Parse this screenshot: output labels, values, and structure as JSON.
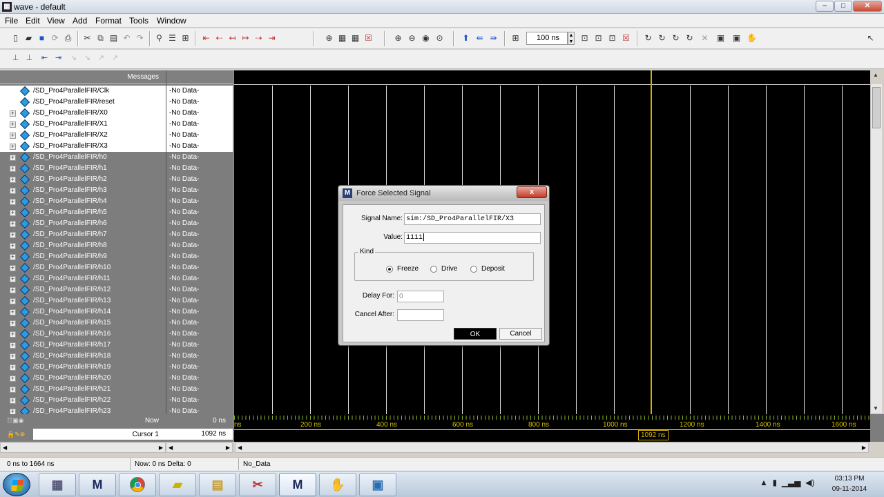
{
  "window": {
    "title": "wave - default",
    "controls": [
      "–",
      "□",
      "✕"
    ]
  },
  "menu": [
    "File",
    "Edit",
    "View",
    "Add",
    "Format",
    "Tools",
    "Window"
  ],
  "toolbar": {
    "time_value": "100 ns"
  },
  "messages_header": "Messages",
  "signals": [
    {
      "name": "/SD_Pro4ParallelFIR/Clk",
      "value": "-No Data-",
      "expandable": false,
      "selected": true
    },
    {
      "name": "/SD_Pro4ParallelFIR/reset",
      "value": "-No Data-",
      "expandable": false,
      "selected": true
    },
    {
      "name": "/SD_Pro4ParallelFIR/X0",
      "value": "-No Data-",
      "expandable": true,
      "selected": true
    },
    {
      "name": "/SD_Pro4ParallelFIR/X1",
      "value": "-No Data-",
      "expandable": true,
      "selected": true
    },
    {
      "name": "/SD_Pro4ParallelFIR/X2",
      "value": "-No Data-",
      "expandable": true,
      "selected": true
    },
    {
      "name": "/SD_Pro4ParallelFIR/X3",
      "value": "-No Data-",
      "expandable": true,
      "selected": true
    },
    {
      "name": "/SD_Pro4ParallelFIR/h0",
      "value": "-No Data-",
      "expandable": true,
      "selected": false
    },
    {
      "name": "/SD_Pro4ParallelFIR/h1",
      "value": "-No Data-",
      "expandable": true,
      "selected": false
    },
    {
      "name": "/SD_Pro4ParallelFIR/h2",
      "value": "-No Data-",
      "expandable": true,
      "selected": false
    },
    {
      "name": "/SD_Pro4ParallelFIR/h3",
      "value": "-No Data-",
      "expandable": true,
      "selected": false
    },
    {
      "name": "/SD_Pro4ParallelFIR/h4",
      "value": "-No Data-",
      "expandable": true,
      "selected": false
    },
    {
      "name": "/SD_Pro4ParallelFIR/h5",
      "value": "-No Data-",
      "expandable": true,
      "selected": false
    },
    {
      "name": "/SD_Pro4ParallelFIR/h6",
      "value": "-No Data-",
      "expandable": true,
      "selected": false
    },
    {
      "name": "/SD_Pro4ParallelFIR/h7",
      "value": "-No Data-",
      "expandable": true,
      "selected": false
    },
    {
      "name": "/SD_Pro4ParallelFIR/h8",
      "value": "-No Data-",
      "expandable": true,
      "selected": false
    },
    {
      "name": "/SD_Pro4ParallelFIR/h9",
      "value": "-No Data-",
      "expandable": true,
      "selected": false
    },
    {
      "name": "/SD_Pro4ParallelFIR/h10",
      "value": "-No Data-",
      "expandable": true,
      "selected": false
    },
    {
      "name": "/SD_Pro4ParallelFIR/h11",
      "value": "-No Data-",
      "expandable": true,
      "selected": false
    },
    {
      "name": "/SD_Pro4ParallelFIR/h12",
      "value": "-No Data-",
      "expandable": true,
      "selected": false
    },
    {
      "name": "/SD_Pro4ParallelFIR/h13",
      "value": "-No Data-",
      "expandable": true,
      "selected": false
    },
    {
      "name": "/SD_Pro4ParallelFIR/h14",
      "value": "-No Data-",
      "expandable": true,
      "selected": false
    },
    {
      "name": "/SD_Pro4ParallelFIR/h15",
      "value": "-No Data-",
      "expandable": true,
      "selected": false
    },
    {
      "name": "/SD_Pro4ParallelFIR/h16",
      "value": "-No Data-",
      "expandable": true,
      "selected": false
    },
    {
      "name": "/SD_Pro4ParallelFIR/h17",
      "value": "-No Data-",
      "expandable": true,
      "selected": false
    },
    {
      "name": "/SD_Pro4ParallelFIR/h18",
      "value": "-No Data-",
      "expandable": true,
      "selected": false
    },
    {
      "name": "/SD_Pro4ParallelFIR/h19",
      "value": "-No Data-",
      "expandable": true,
      "selected": false
    },
    {
      "name": "/SD_Pro4ParallelFIR/h20",
      "value": "-No Data-",
      "expandable": true,
      "selected": false
    },
    {
      "name": "/SD_Pro4ParallelFIR/h21",
      "value": "-No Data-",
      "expandable": true,
      "selected": false
    },
    {
      "name": "/SD_Pro4ParallelFIR/h22",
      "value": "-No Data-",
      "expandable": true,
      "selected": false
    },
    {
      "name": "/SD_Pro4ParallelFIR/h23",
      "value": "-No Data-",
      "expandable": true,
      "selected": false
    }
  ],
  "now": {
    "label": "Now",
    "value": "0 ns"
  },
  "cursor": {
    "label": "Cursor 1",
    "value": "1092 ns",
    "badge": "1092 ns"
  },
  "timeline_labels": [
    "ns",
    "200 ns",
    "400 ns",
    "600 ns",
    "800 ns",
    "1000 ns",
    "1200 ns",
    "1400 ns",
    "1600 ns"
  ],
  "status": {
    "range": "0 ns to 1664 ns",
    "now_delta": "Now: 0 ns  Delta: 0",
    "data": "No_Data"
  },
  "dialog": {
    "title": "Force Selected Signal",
    "close": "x",
    "signal_name_label": "Signal Name:",
    "signal_name_value": "sim:/SD_Pro4ParallelFIR/X3",
    "value_label": "Value:",
    "value_value": "1111",
    "kind_label": "Kind",
    "kind_options": [
      {
        "label": "Freeze",
        "selected": true
      },
      {
        "label": "Drive",
        "selected": false
      },
      {
        "label": "Deposit",
        "selected": false
      }
    ],
    "delay_label": "Delay For:",
    "delay_value": "0",
    "cancel_after_label": "Cancel After:",
    "cancel_after_value": "",
    "ok_label": "OK",
    "cancel_label": "Cancel"
  },
  "taskbar": {
    "apps": [
      "calculator-app",
      "modelsim-app",
      "chrome-app",
      "sticky-notes-app",
      "explorer-app",
      "snipping-tool-app",
      "modelsim-active-app",
      "gimp-app",
      "paint-app"
    ],
    "modelsim_letter": "M",
    "clock_time": "03:13 PM",
    "clock_date": "09-11-2014"
  }
}
